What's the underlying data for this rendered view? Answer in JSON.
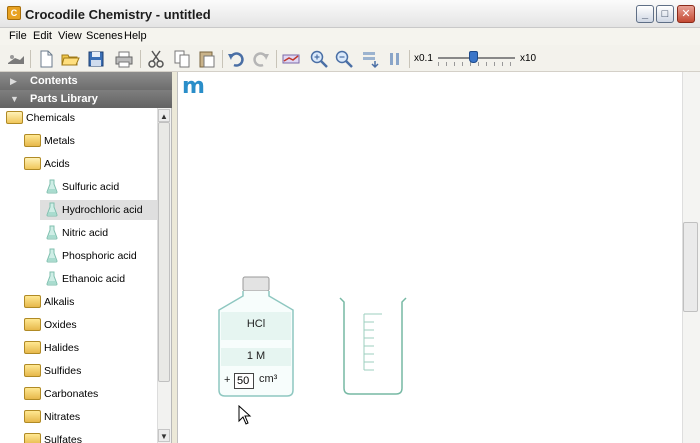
{
  "window": {
    "title": "Crocodile Chemistry - untitled",
    "app_icon_letter": "C",
    "minimize_glyph": "_",
    "maximize_glyph": "□",
    "close_glyph": "✕"
  },
  "menu": {
    "file": "File",
    "edit": "Edit",
    "view": "View",
    "scenes": "Scenes",
    "help": "Help"
  },
  "toolbar": {
    "zoom_min_label": "x0.1",
    "zoom_max_label": "x10",
    "zoom_level_fraction": 0.45,
    "icons": [
      "open-parts-icon",
      "new-file-icon",
      "open-folder-icon",
      "save-icon",
      "print-icon",
      "cut-icon",
      "copy-icon",
      "paste-icon",
      "undo-icon",
      "redo-icon",
      "graph-icon",
      "zoom-in-icon",
      "zoom-out-icon",
      "fit-icon",
      "pause-icon"
    ]
  },
  "sidebar": {
    "contents_label": "Contents",
    "parts_library_label": "Parts Library",
    "tree": [
      {
        "label": "Chemicals",
        "kind": "folder-open",
        "level": 0
      },
      {
        "label": "Metals",
        "kind": "folder",
        "level": 1
      },
      {
        "label": "Acids",
        "kind": "folder-open",
        "level": 1
      },
      {
        "label": "Sulfuric acid",
        "kind": "flask",
        "level": 2
      },
      {
        "label": "Hydrochloric acid",
        "kind": "flask",
        "level": 2,
        "selected": true
      },
      {
        "label": "Nitric acid",
        "kind": "flask",
        "level": 2
      },
      {
        "label": "Phosphoric acid",
        "kind": "flask",
        "level": 2
      },
      {
        "label": "Ethanoic acid",
        "kind": "flask",
        "level": 2
      },
      {
        "label": "Alkalis",
        "kind": "folder",
        "level": 1
      },
      {
        "label": "Oxides",
        "kind": "folder",
        "level": 1
      },
      {
        "label": "Halides",
        "kind": "folder",
        "level": 1
      },
      {
        "label": "Sulfides",
        "kind": "folder",
        "level": 1
      },
      {
        "label": "Carbonates",
        "kind": "folder",
        "level": 1
      },
      {
        "label": "Nitrates",
        "kind": "folder",
        "level": 1
      },
      {
        "label": "Sulfates",
        "kind": "folder",
        "level": 1
      }
    ]
  },
  "canvas": {
    "logo": "m",
    "bottle": {
      "chemical": "HCl",
      "concentration": "1 M",
      "plus_sign": "+",
      "volume_value": "50",
      "volume_unit": "cm³"
    }
  },
  "colors": {
    "bottle_outline": "#8ec7c0",
    "bottle_label_bg": "#e6f5f1",
    "beaker_outline": "#77b9a4",
    "logo": "#2a8ec9",
    "panel_header": "#7a7a7a"
  }
}
